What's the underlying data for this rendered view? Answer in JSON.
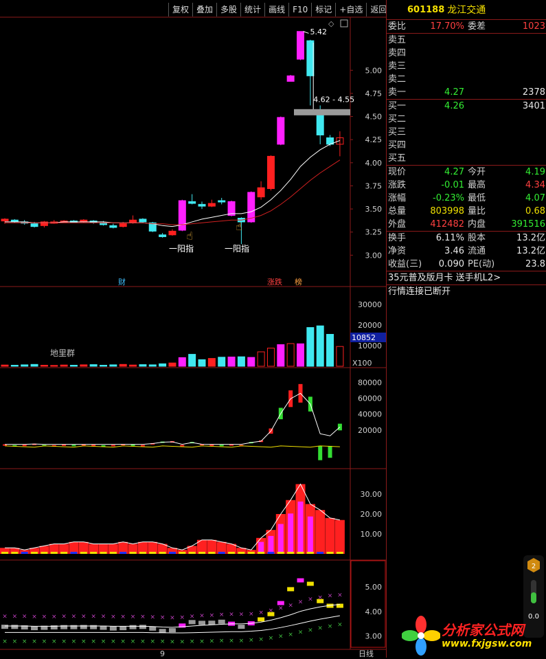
{
  "toolbar": [
    "复权",
    "叠加",
    "多股",
    "统计",
    "画线",
    "F10",
    "标记",
    "+自选",
    "返回"
  ],
  "stock": {
    "code": "601188",
    "name": "龙江交通"
  },
  "quote": {
    "weibi_label": "委比",
    "weibi": "17.70%",
    "weicha_label": "委差",
    "weicha": "1023",
    "sell": [
      {
        "label": "卖五",
        "price": "",
        "vol": ""
      },
      {
        "label": "卖四",
        "price": "",
        "vol": ""
      },
      {
        "label": "卖三",
        "price": "",
        "vol": ""
      },
      {
        "label": "卖二",
        "price": "",
        "vol": ""
      },
      {
        "label": "卖一",
        "price": "4.27",
        "vol": "2378"
      }
    ],
    "buy": [
      {
        "label": "买一",
        "price": "4.26",
        "vol": "3401"
      },
      {
        "label": "买二",
        "price": "",
        "vol": ""
      },
      {
        "label": "买三",
        "price": "",
        "vol": ""
      },
      {
        "label": "买四",
        "price": "",
        "vol": ""
      },
      {
        "label": "买五",
        "price": "",
        "vol": ""
      }
    ],
    "stats": [
      {
        "l1": "现价",
        "v1": "4.27",
        "c1": "green",
        "l2": "今开",
        "v2": "4.19",
        "c2": "green"
      },
      {
        "l1": "涨跌",
        "v1": "-0.01",
        "c1": "green",
        "l2": "最高",
        "v2": "4.34",
        "c2": "red"
      },
      {
        "l1": "涨幅",
        "v1": "-0.23%",
        "c1": "green",
        "l2": "最低",
        "v2": "4.07",
        "c2": "green"
      },
      {
        "l1": "总量",
        "v1": "803998",
        "c1": "yellow",
        "l2": "量比",
        "v2": "0.68",
        "c2": "yellow"
      },
      {
        "l1": "外盘",
        "v1": "412482",
        "c1": "red",
        "l2": "内盘",
        "v2": "391516",
        "c2": "green"
      }
    ],
    "stats2": [
      {
        "l1": "换手",
        "v1": "6.11%",
        "c1": "white",
        "l2": "股本",
        "v2": "13.2亿",
        "c2": "white"
      },
      {
        "l1": "净资",
        "v1": "3.46",
        "c1": "white",
        "l2": "流通",
        "v2": "13.2亿",
        "c2": "white"
      },
      {
        "l1": "收益(三)",
        "v1": "0.090",
        "c1": "white",
        "l2": "PE(动)",
        "v2": "23.8",
        "c2": "white"
      }
    ],
    "ad1": "35元普及版月卡 送手机L2>",
    "ad2": "行情连接已断开"
  },
  "chart_labels": {
    "high_price": "5.42",
    "range": "4.62 - 4.55",
    "annot1": "一阳指",
    "annot2": "一阳指",
    "marker_cai": "财",
    "marker_zd": "涨跌",
    "marker_bang": "榜",
    "vol_label": "地里群",
    "vol_current": "10852",
    "vol_unit": "X100",
    "period": "日线",
    "date_tick": "9"
  },
  "colors": {
    "up": "#ff2020",
    "down": "#40e8f0",
    "magenta": "#ff20ff",
    "grid": "#8b1a1a",
    "axis": "#d0d0d0"
  },
  "logo": {
    "name": "分析家公式网",
    "url": "www.fxjgsw.com"
  },
  "widget": {
    "badge": "2",
    "value": "0.0"
  },
  "chart_data": [
    {
      "type": "candlestick",
      "title": "",
      "ylim": [
        2.75,
        5.5
      ],
      "yticks": [
        3.0,
        3.25,
        3.5,
        3.75,
        4.0,
        4.25,
        4.5,
        4.75,
        5.0
      ],
      "candles": [
        [
          3.37,
          3.39,
          3.4,
          3.34
        ],
        [
          3.38,
          3.37,
          3.39,
          3.35
        ],
        [
          3.36,
          3.35,
          3.38,
          3.33
        ],
        [
          3.34,
          3.31,
          3.36,
          3.3
        ],
        [
          3.32,
          3.36,
          3.37,
          3.3
        ],
        [
          3.35,
          3.36,
          3.38,
          3.34
        ],
        [
          3.36,
          3.37,
          3.38,
          3.35
        ],
        [
          3.37,
          3.36,
          3.38,
          3.35
        ],
        [
          3.36,
          3.38,
          3.39,
          3.35
        ],
        [
          3.37,
          3.36,
          3.38,
          3.34
        ],
        [
          3.35,
          3.33,
          3.37,
          3.32
        ],
        [
          3.32,
          3.3,
          3.34,
          3.29
        ],
        [
          3.31,
          3.34,
          3.36,
          3.3
        ],
        [
          3.35,
          3.38,
          3.43,
          3.34
        ],
        [
          3.39,
          3.36,
          3.4,
          3.35
        ],
        [
          3.35,
          3.26,
          3.36,
          3.25
        ],
        [
          3.22,
          3.2,
          3.24,
          3.19
        ],
        [
          3.22,
          3.26,
          3.28,
          3.21
        ],
        [
          3.27,
          3.59,
          3.6,
          3.26
        ],
        [
          3.58,
          3.56,
          3.66,
          3.55
        ],
        [
          3.55,
          3.53,
          3.58,
          3.5
        ],
        [
          3.53,
          3.56,
          3.6,
          3.52
        ],
        [
          3.59,
          3.58,
          3.62,
          3.55
        ],
        [
          3.58,
          3.43,
          3.59,
          3.42
        ],
        [
          3.4,
          3.36,
          3.41,
          3.12
        ],
        [
          3.36,
          3.68,
          3.69,
          3.35
        ],
        [
          3.63,
          3.73,
          3.8,
          3.6
        ],
        [
          3.72,
          4.07,
          4.08,
          3.7
        ],
        [
          4.2,
          4.49,
          4.5,
          4.19
        ],
        [
          4.88,
          4.94,
          4.95,
          4.88
        ],
        [
          5.12,
          5.42,
          5.42,
          5.11
        ],
        [
          5.32,
          4.94,
          5.33,
          4.62
        ],
        [
          4.55,
          4.3,
          4.62,
          4.2
        ],
        [
          4.27,
          4.2,
          4.3,
          4.18
        ],
        [
          4.2,
          4.27,
          4.34,
          4.07
        ]
      ],
      "ma": [
        [
          3.36,
          3.35
        ],
        [
          3.36,
          3.35
        ],
        [
          3.36,
          3.35
        ],
        [
          3.35,
          3.35
        ],
        [
          3.35,
          3.35
        ],
        [
          3.35,
          3.35
        ],
        [
          3.36,
          3.35
        ],
        [
          3.36,
          3.35
        ],
        [
          3.36,
          3.35
        ],
        [
          3.36,
          3.35
        ],
        [
          3.36,
          3.35
        ],
        [
          3.35,
          3.35
        ],
        [
          3.35,
          3.35
        ],
        [
          3.35,
          3.35
        ],
        [
          3.35,
          3.35
        ],
        [
          3.34,
          3.34
        ],
        [
          3.32,
          3.34
        ],
        [
          3.31,
          3.33
        ],
        [
          3.33,
          3.33
        ],
        [
          3.36,
          3.34
        ],
        [
          3.39,
          3.35
        ],
        [
          3.41,
          3.36
        ],
        [
          3.43,
          3.37
        ],
        [
          3.45,
          3.38
        ],
        [
          3.45,
          3.38
        ],
        [
          3.47,
          3.4
        ],
        [
          3.52,
          3.43
        ],
        [
          3.6,
          3.48
        ],
        [
          3.7,
          3.55
        ],
        [
          3.82,
          3.63
        ],
        [
          3.96,
          3.72
        ],
        [
          4.06,
          3.81
        ],
        [
          4.14,
          3.89
        ],
        [
          4.2,
          3.96
        ],
        [
          4.24,
          4.03
        ]
      ]
    },
    {
      "type": "bar",
      "title": "",
      "ylabel": "",
      "yticks": [
        10000,
        20000,
        30000
      ],
      "ylim": [
        0,
        36000
      ],
      "values": [
        600,
        500,
        700,
        900,
        500,
        400,
        600,
        500,
        700,
        800,
        500,
        700,
        900,
        600,
        800,
        700,
        1200,
        1600,
        4200,
        5800,
        3200,
        3800,
        4400,
        4500,
        4600,
        4300,
        7000,
        8800,
        10500,
        11000,
        10900,
        18800,
        19600,
        15500,
        9600
      ]
    },
    {
      "type": "bar",
      "title": "",
      "yticks": [
        20000,
        40000,
        60000,
        80000
      ],
      "ylim": [
        0,
        90000
      ],
      "values": [
        2000,
        1000,
        1500,
        2800,
        1200,
        1000,
        1800,
        1400,
        2200,
        1500,
        900,
        1300,
        2500,
        1800,
        1200,
        3500,
        5500,
        6000,
        1200,
        5000,
        2500,
        1800,
        1400,
        2000,
        1200,
        5000,
        7000,
        22000,
        48000,
        70000,
        78000,
        62000,
        -18000,
        -15000,
        28000
      ]
    },
    {
      "type": "bar",
      "title": "",
      "yticks": [
        10,
        20,
        30
      ],
      "ylim": [
        0,
        40
      ],
      "values": [
        3,
        3,
        2,
        3,
        4,
        5,
        5,
        6,
        6,
        5,
        5,
        5,
        6,
        5,
        6,
        6,
        5,
        3,
        2,
        4,
        7,
        7,
        6,
        5,
        3,
        2,
        8,
        12,
        20,
        27,
        35,
        25,
        22,
        18,
        17
      ]
    },
    {
      "type": "scatter",
      "title": "",
      "yticks": [
        3.0,
        4.0,
        5.0
      ],
      "ylim": [
        2.6,
        5.9
      ]
    }
  ]
}
